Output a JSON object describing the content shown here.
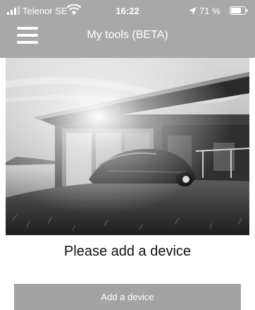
{
  "status_bar": {
    "carrier": "Telenor SE",
    "time": "16:22",
    "battery": "71 %",
    "icons": [
      "signal-icon",
      "wifi-icon",
      "location-arrow-icon",
      "battery-icon"
    ]
  },
  "navbar": {
    "title": "My tools (BETA)",
    "menu_icon": "hamburger-menu-icon"
  },
  "main": {
    "prompt": "Please add a device",
    "add_device_label": "Add a device"
  },
  "colors": {
    "header_bg": "#a8a8a8",
    "button_bg": "#a3a3a3",
    "text": "#111111"
  }
}
